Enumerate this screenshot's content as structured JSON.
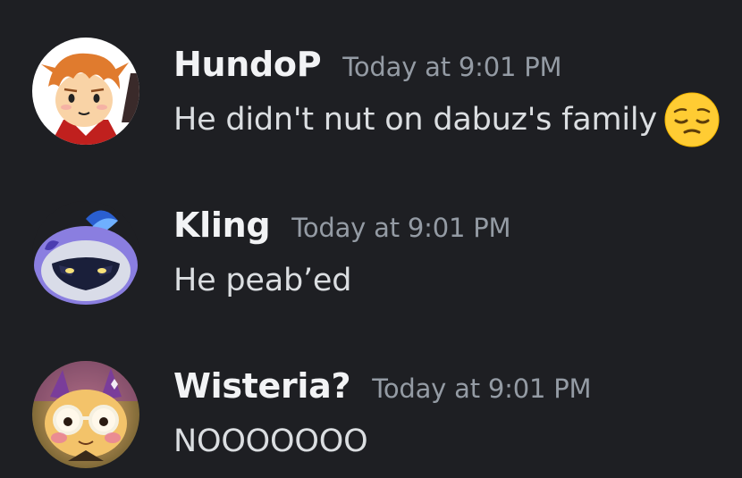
{
  "messages": [
    {
      "username": "HundoP",
      "timestamp": "Today at 9:01 PM",
      "text": "He didn't nut on dabuz's family",
      "emoji": "pensive-face-icon"
    },
    {
      "username": "Kling",
      "timestamp": "Today at 9:01 PM",
      "text": "He peab’ed"
    },
    {
      "username": "Wisteria?",
      "timestamp": "Today at 9:01 PM",
      "text": "NOOOOOOO"
    }
  ],
  "colors": {
    "background": "#1e1f23",
    "username": "#f2f3f5",
    "timestamp": "#949ba4",
    "message_text": "#dbdee1"
  }
}
